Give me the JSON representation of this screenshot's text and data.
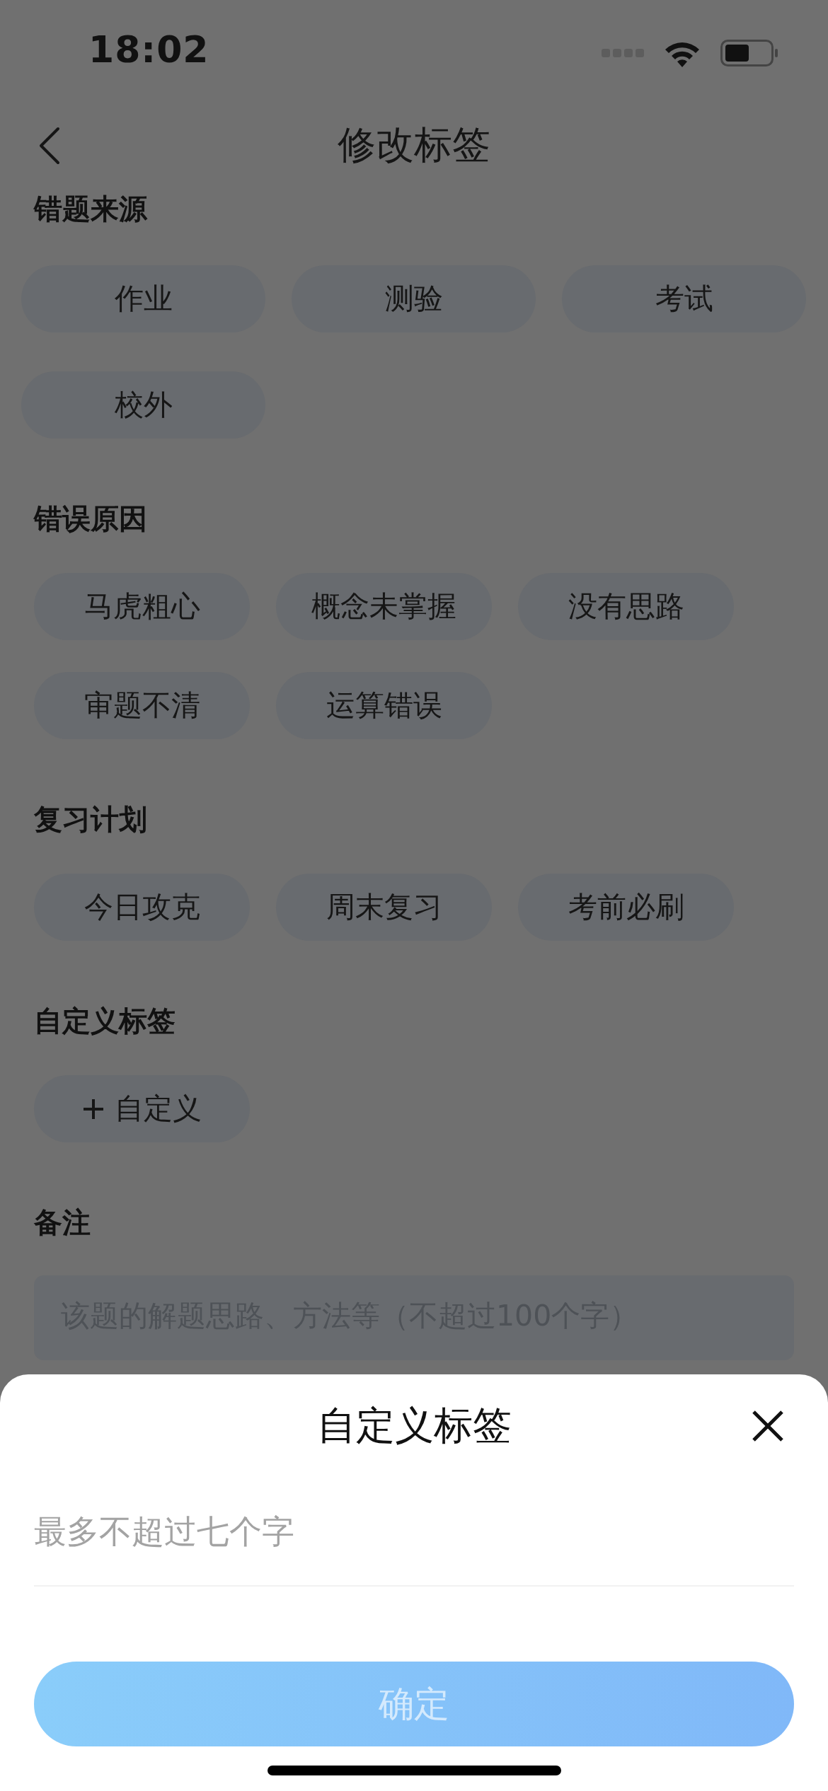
{
  "status_bar": {
    "time": "18:02"
  },
  "nav": {
    "title": "修改标签"
  },
  "sections": [
    {
      "title": "错题来源",
      "tags": [
        {
          "label": "作业"
        },
        {
          "label": "测验"
        },
        {
          "label": "考试"
        },
        {
          "label": "校外"
        }
      ]
    },
    {
      "title": "错误原因",
      "tags": [
        {
          "label": "马虎粗心"
        },
        {
          "label": "概念未掌握"
        },
        {
          "label": "没有思路"
        },
        {
          "label": "审题不清"
        },
        {
          "label": "运算错误"
        }
      ]
    },
    {
      "title": "复习计划",
      "tags": [
        {
          "label": "今日攻克"
        },
        {
          "label": "周末复习"
        },
        {
          "label": "考前必刷"
        }
      ]
    },
    {
      "title": "自定义标签",
      "tags": [
        {
          "label": "自定义",
          "kind": "add"
        }
      ]
    }
  ],
  "note": {
    "title": "备注",
    "placeholder": "该题的解题思路、方法等（不超过100个字）"
  },
  "sheet": {
    "title": "自定义标签",
    "input": {
      "placeholder": "最多不超过七个字"
    },
    "confirm_button": {
      "label": "确定",
      "disabled": true
    }
  }
}
